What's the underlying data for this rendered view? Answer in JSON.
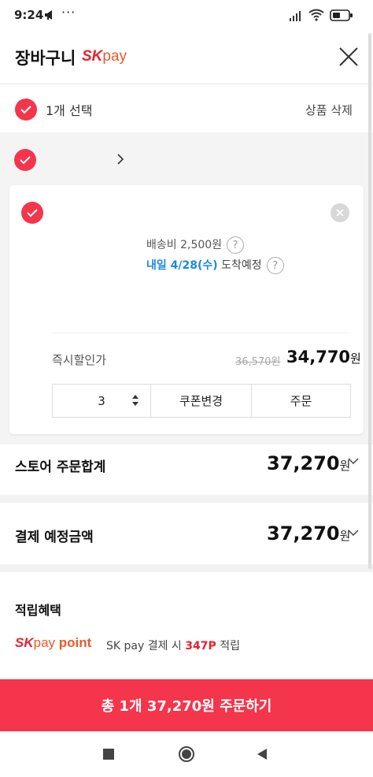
{
  "status_bar": {
    "time": "9:24",
    "dots": "···"
  },
  "header": {
    "title": "장바구니",
    "brand_sk": "SK",
    "brand_pay": "pay"
  },
  "selection": {
    "label": "1개 선택",
    "delete": "상품 삭제"
  },
  "item": {
    "shipping_label": "배송비 2,500원",
    "arrival_date": "내일 4/28(수)",
    "arrival_suffix": "도착예정",
    "discount_label": "즉시할인가",
    "original_price": "36,570원",
    "sale_price": "34,770",
    "won": "원",
    "quantity": "3",
    "coupon_button": "쿠폰변경",
    "order_button": "주문",
    "help_mark": "?"
  },
  "store_total": {
    "label": "스토어 주문합계",
    "amount": "37,270",
    "won": "원"
  },
  "payment_total": {
    "label": "결제 예정금액",
    "amount": "37,270",
    "won": "원"
  },
  "benefits": {
    "title": "적립혜택",
    "logo_sk": "SK",
    "logo_pay": "pay",
    "logo_point": "point",
    "text_prefix": "SK pay 결제 시",
    "points": "347P",
    "text_suffix": "적립"
  },
  "order_bar": {
    "label": "총 1개 37,270원 주문하기"
  },
  "colors": {
    "accent": "#f4354b",
    "link_blue": "#1b8ad8",
    "brand_orange": "#e85a2a"
  }
}
